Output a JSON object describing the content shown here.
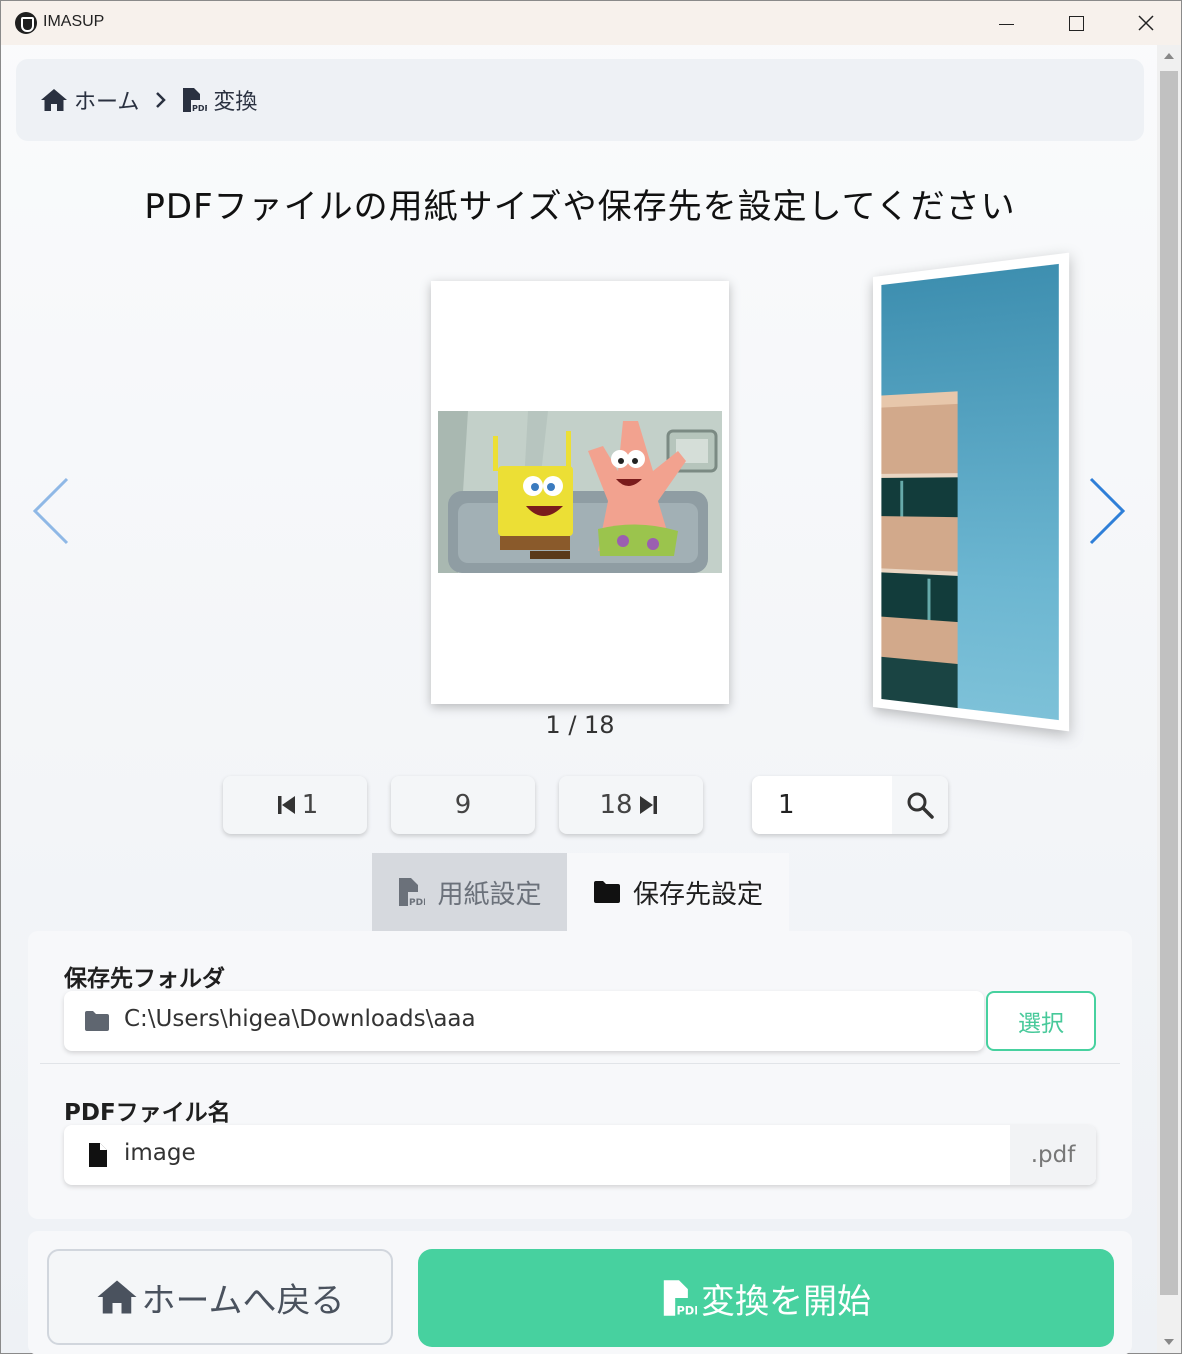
{
  "window": {
    "title": "IMASUP"
  },
  "breadcrumb": {
    "home": "ホーム",
    "current": "変換"
  },
  "heading": "PDFファイルの用紙サイズや保存先を設定してください",
  "preview": {
    "page_indicator": "1 / 18"
  },
  "pagination": {
    "first": "1",
    "middle": "9",
    "last": "18",
    "page_input_value": "1"
  },
  "tabs": {
    "paper": "用紙設定",
    "destination": "保存先設定"
  },
  "destination": {
    "folder_label": "保存先フォルダ",
    "folder_path": "C:\\Users\\higea\\Downloads\\aaa",
    "select_button": "選択",
    "filename_label": "PDFファイル名",
    "filename_value": "image",
    "extension": ".pdf"
  },
  "footer": {
    "back_button": "ホームへ戻る",
    "start_button": "変換を開始"
  },
  "colors": {
    "accent": "#47d19f",
    "tab_inactive": "#d6d9de",
    "nav_arrow": "#2f7fd8"
  }
}
